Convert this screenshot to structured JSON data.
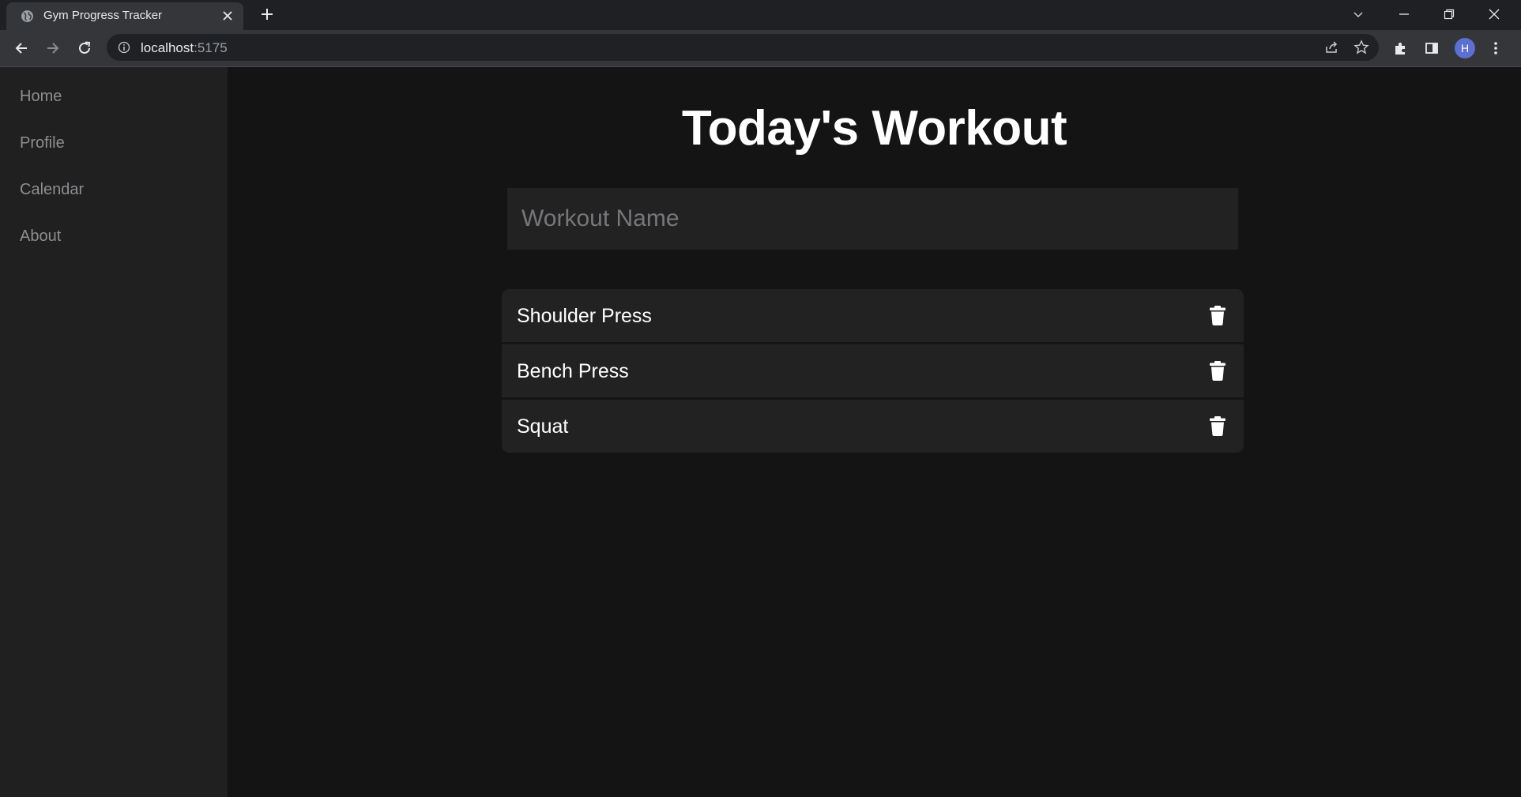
{
  "browser": {
    "tab_title": "Gym Progress Tracker",
    "url_host": "localhost",
    "url_port": ":5175",
    "profile_initial": "H"
  },
  "sidebar": {
    "items": [
      {
        "label": "Home"
      },
      {
        "label": "Profile"
      },
      {
        "label": "Calendar"
      },
      {
        "label": "About"
      }
    ]
  },
  "main": {
    "title": "Today's Workout",
    "workout_name_placeholder": "Workout Name",
    "workout_name_value": "",
    "exercises": [
      {
        "name": "Shoulder Press",
        "action_icon": "trash-icon"
      },
      {
        "name": "Bench Press",
        "action_icon": "trash-icon"
      },
      {
        "name": "Squat",
        "action_icon": "trash-icon"
      }
    ]
  },
  "colors": {
    "page_bg": "#141415",
    "sidebar_bg": "#202021",
    "card_bg": "#222223",
    "nav_text": "#8e8e90",
    "avatar": "#5d6fd1"
  }
}
